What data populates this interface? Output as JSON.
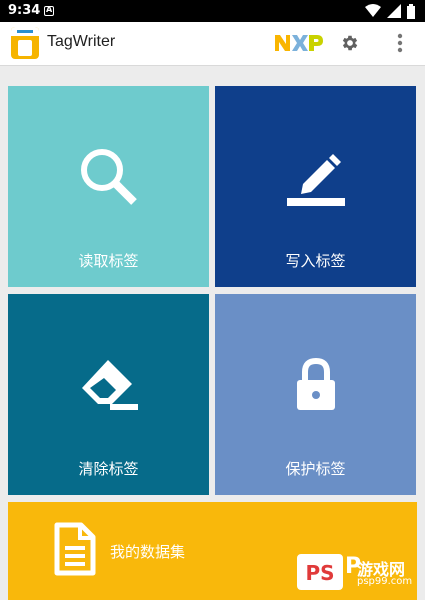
{
  "status_bar": {
    "time": "9:34"
  },
  "app_bar": {
    "title": "TagWriter",
    "brand_logo": "NXP"
  },
  "tiles": {
    "read": {
      "label": "读取标签",
      "icon": "search-icon",
      "color": "#6ecbcd"
    },
    "write": {
      "label": "写入标签",
      "icon": "pencil-icon",
      "color": "#0f3f8b"
    },
    "clear": {
      "label": "清除标签",
      "icon": "eraser-icon",
      "color": "#066b8a"
    },
    "protect": {
      "label": "保护标签",
      "icon": "lock-icon",
      "color": "#6a8fc6"
    },
    "datasets": {
      "label": "我的数据集",
      "icon": "document-icon",
      "color": "#f9b80b"
    }
  },
  "watermark": {
    "badge": "PS",
    "letter": "P",
    "name": "游戏网",
    "url": "psp99.com"
  }
}
